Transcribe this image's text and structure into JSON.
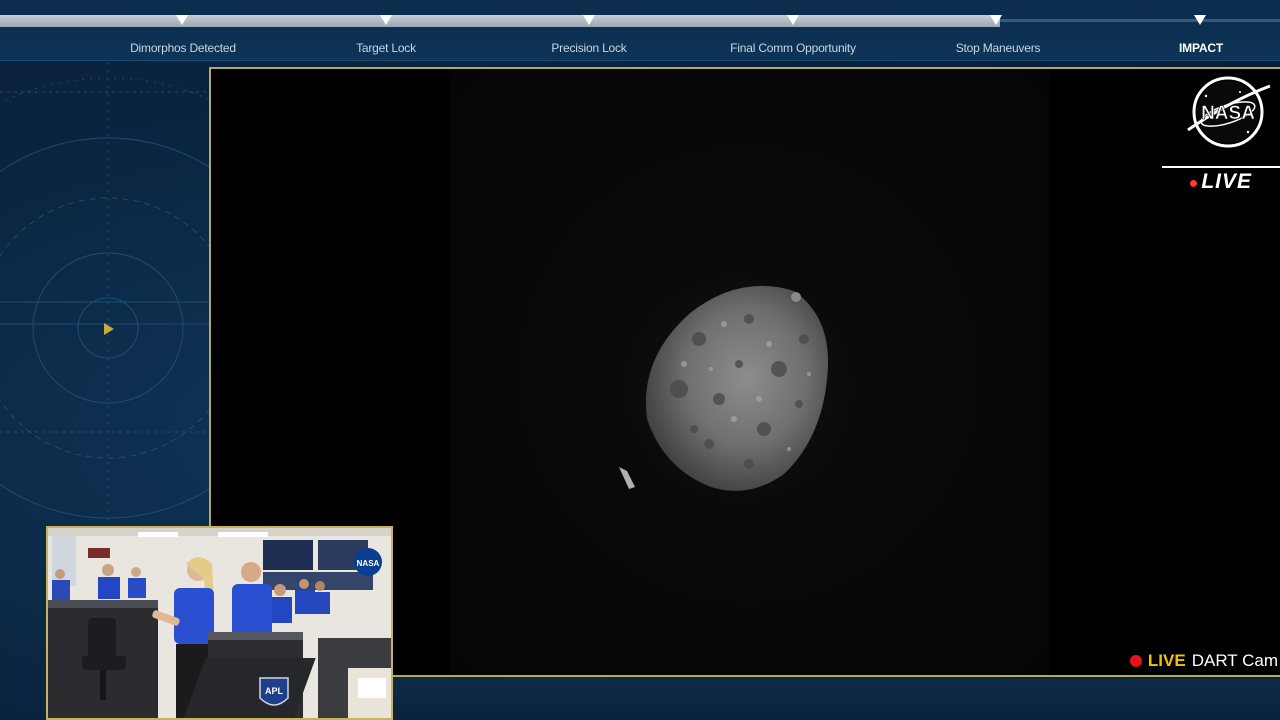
{
  "timeline": {
    "milestones": [
      {
        "label": "Dimorphos Detected",
        "active": false
      },
      {
        "label": "Target Lock",
        "active": false
      },
      {
        "label": "Precision Lock",
        "active": false
      },
      {
        "label": "Final Comm Opportunity",
        "active": false
      },
      {
        "label": "Stop Maneuvers",
        "active": false
      },
      {
        "label": "IMPACT",
        "active": true
      }
    ]
  },
  "broadcast": {
    "logo_icon": "nasa-meatball-icon",
    "live_label": "LIVE"
  },
  "camera": {
    "status_label": "LIVE",
    "camera_name": "DART Cam",
    "status_color": "#e3131b"
  },
  "colors": {
    "frame_border": "#b8a85a",
    "background": "#0b2744",
    "live_accent": "#f2c300"
  }
}
